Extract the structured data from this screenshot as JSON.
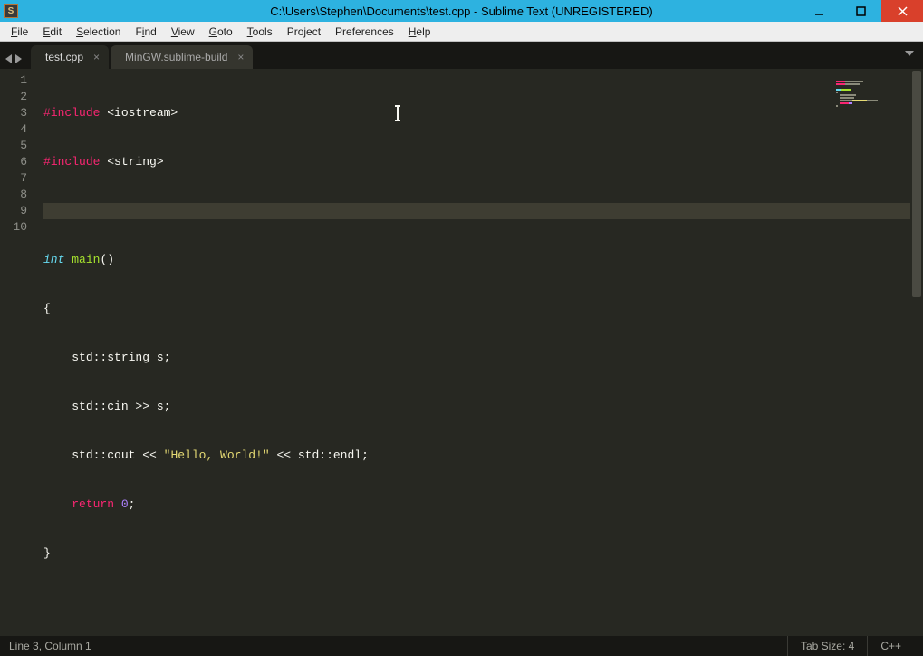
{
  "window": {
    "title": "C:\\Users\\Stephen\\Documents\\test.cpp - Sublime Text (UNREGISTERED)"
  },
  "menu": {
    "file": "File",
    "edit": "Edit",
    "selection": "Selection",
    "find": "Find",
    "view": "View",
    "goto": "Goto",
    "tools": "Tools",
    "project": "Project",
    "preferences": "Preferences",
    "help": "Help"
  },
  "tabs": [
    {
      "label": "test.cpp",
      "active": true
    },
    {
      "label": "MinGW.sublime-build",
      "active": false
    }
  ],
  "gutter": [
    "1",
    "2",
    "3",
    "4",
    "5",
    "6",
    "7",
    "8",
    "9",
    "10"
  ],
  "code": {
    "l1_hash": "#",
    "l1_include": "include",
    "l1_rest": " <iostream>",
    "l2_hash": "#",
    "l2_include": "include",
    "l2_rest": " <string>",
    "l3": "",
    "l4_int": "int",
    "l4_sp": " ",
    "l4_main": "main",
    "l4_parens": "()",
    "l5": "{",
    "l6_indent": "    ",
    "l6_rest": "std::string s;",
    "l7_indent": "    ",
    "l7_rest": "std::cin >> s;",
    "l8_indent": "    ",
    "l8_a": "std::cout << ",
    "l8_str": "\"Hello, World!\"",
    "l8_b": " << std::endl;",
    "l9_indent": "    ",
    "l9_ret": "return",
    "l9_sp": " ",
    "l9_zero": "0",
    "l9_semi": ";",
    "l10": "}"
  },
  "status": {
    "position": "Line 3, Column 1",
    "tabsize": "Tab Size: 4",
    "syntax": "C++"
  }
}
